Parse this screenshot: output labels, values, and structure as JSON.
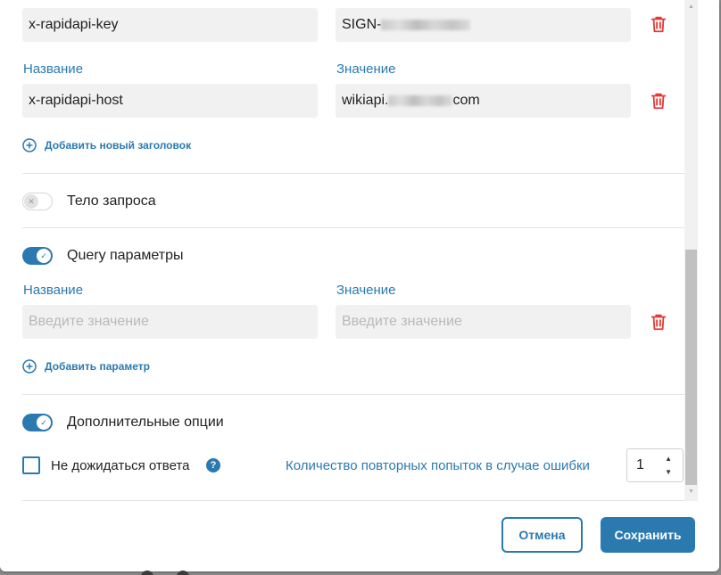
{
  "headers": {
    "rows": [
      {
        "name": "x-rapidapi-key",
        "value_prefix": "SIGN-",
        "value_suffix": "",
        "delete_label": "trash-icon"
      },
      {
        "name": "x-rapidapi-host",
        "value_prefix": "wikiapi.",
        "value_suffix": "com",
        "delete_label": "trash-icon"
      }
    ],
    "name_label": "Название",
    "value_label": "Значение",
    "add_label": "Добавить новый заголовок"
  },
  "body_toggle": {
    "label": "Тело запроса",
    "enabled": false
  },
  "query": {
    "toggle_label": "Query параметры",
    "enabled": true,
    "name_label": "Название",
    "value_label": "Значение",
    "name_placeholder": "Введите значение",
    "value_placeholder": "Введите значение",
    "add_label": "Добавить параметр"
  },
  "options": {
    "toggle_label": "Дополнительные опции",
    "enabled": true,
    "no_wait_label": "Не дожидаться ответа",
    "no_wait_checked": false,
    "help_glyph": "?",
    "retry_label": "Количество повторных попыток в случае ошибки",
    "retry_value": "1"
  },
  "footer": {
    "cancel_label": "Отмена",
    "save_label": "Сохранить"
  },
  "colors": {
    "accent": "#2a7ab0",
    "danger": "#e53935",
    "field_bg": "#f1f1f1"
  },
  "icons": {
    "add": "plus-circle-icon",
    "delete": "trash-icon",
    "help": "question-icon",
    "check": "check-icon"
  }
}
